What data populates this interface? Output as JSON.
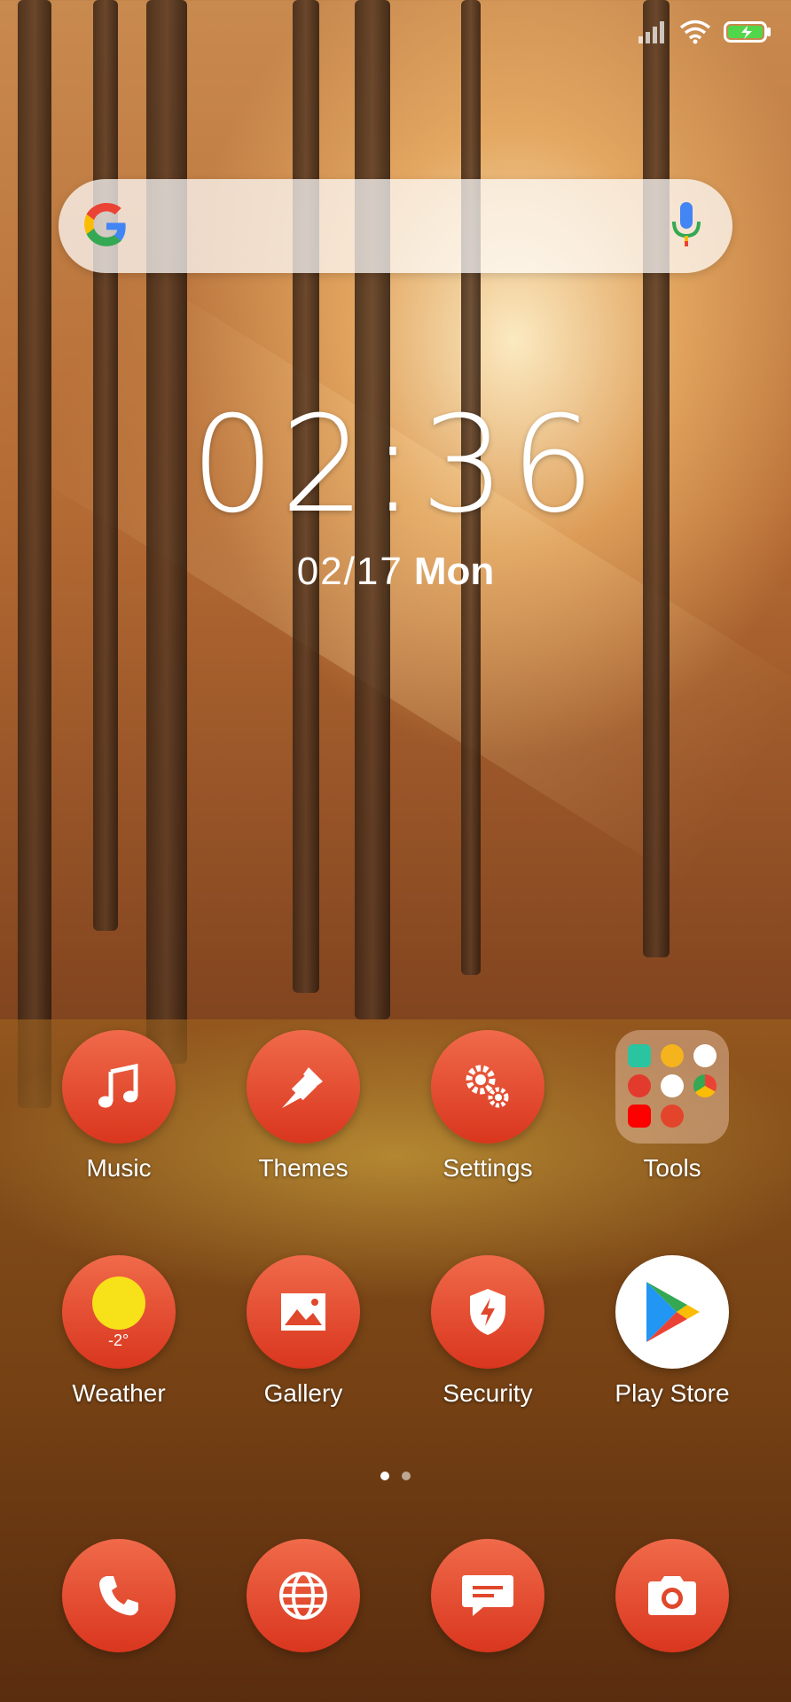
{
  "status": {
    "signal_icon": "signal-icon",
    "wifi_icon": "wifi-icon",
    "battery_icon": "battery-charging-icon"
  },
  "search": {
    "logo": "google-g-icon",
    "mic_icon": "mic-icon"
  },
  "clock": {
    "time": "02:36",
    "date_md": "02/17",
    "date_dow": "Mon"
  },
  "apps_row1": [
    {
      "label": "Music",
      "icon": "music-note-icon"
    },
    {
      "label": "Themes",
      "icon": "paintbrush-icon"
    },
    {
      "label": "Settings",
      "icon": "gears-icon"
    },
    {
      "label": "Tools",
      "icon": "folder-icon"
    }
  ],
  "apps_row2": [
    {
      "label": "Weather",
      "icon": "sun-cloud-icon",
      "temp": "-2°"
    },
    {
      "label": "Gallery",
      "icon": "image-icon"
    },
    {
      "label": "Security",
      "icon": "shield-bolt-icon"
    },
    {
      "label": "Play Store",
      "icon": "play-store-icon"
    }
  ],
  "dock": [
    {
      "icon": "phone-icon"
    },
    {
      "icon": "globe-icon"
    },
    {
      "icon": "message-icon"
    },
    {
      "icon": "camera-icon"
    }
  ],
  "colors": {
    "icon_red_top": "#f06a4a",
    "icon_red_bottom": "#d9361e"
  },
  "pager": {
    "pages": 2,
    "active": 1
  }
}
